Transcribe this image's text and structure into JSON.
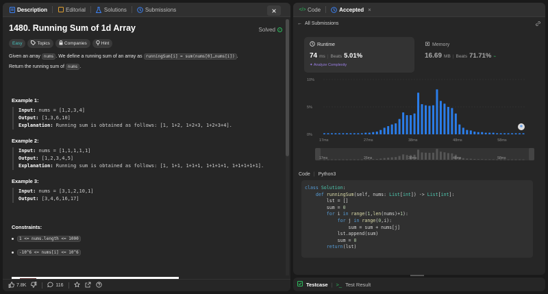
{
  "left_tabs": [
    {
      "label": "Description",
      "icon": "document-icon",
      "active": true
    },
    {
      "label": "Editorial",
      "icon": "book-icon",
      "active": false
    },
    {
      "label": "Solutions",
      "icon": "flask-icon",
      "active": false
    },
    {
      "label": "Submissions",
      "icon": "history-icon",
      "active": false
    }
  ],
  "close_label": "×",
  "problem": {
    "title": "1480. Running Sum of 1d Array",
    "status": "Solved",
    "tags": [
      {
        "label": "Easy",
        "icon": ""
      },
      {
        "label": "Topics",
        "icon": "tag-icon"
      },
      {
        "label": "Companies",
        "icon": "lock-icon"
      },
      {
        "label": "Hint",
        "icon": "bulb-icon"
      }
    ],
    "desc_p1": "Given an array ",
    "desc_c1": "nums",
    "desc_p2": ". We define a running sum of an array as ",
    "desc_c2": "runningSum[i] = sum(nums[0]…nums[i])",
    "desc_p3": ".",
    "ret_p1": "Return the running sum of ",
    "ret_c1": "nums",
    "ret_p2": "."
  },
  "examples": [
    {
      "title": "Example 1:",
      "input_label": "Input:",
      "input": " nums = [1,2,3,4]",
      "output_label": "Output:",
      "output": " [1,3,6,10]",
      "expl_label": "Explanation:",
      "expl": " Running sum is obtained as follows: [1, 1+2, 1+2+3, 1+2+3+4]."
    },
    {
      "title": "Example 2:",
      "input_label": "Input:",
      "input": " nums = [1,1,1,1,1]",
      "output_label": "Output:",
      "output": " [1,2,3,4,5]",
      "expl_label": "Explanation:",
      "expl": " Running sum is obtained as follows: [1, 1+1, 1+1+1, 1+1+1+1, 1+1+1+1+1]."
    },
    {
      "title": "Example 3:",
      "input_label": "Input:",
      "input": " nums = [3,1,2,10,1]",
      "output_label": "Output:",
      "output": " [3,4,6,16,17]"
    }
  ],
  "constraints": {
    "title": "Constraints:",
    "items": [
      "1 <= nums.length <= 1000",
      "-10^6 <= nums[i] <= 10^6"
    ]
  },
  "bottom": {
    "likes": "7.8K",
    "comments": "116"
  },
  "right_tabs": [
    {
      "label": "Code",
      "icon": "code-icon",
      "active": false
    },
    {
      "label": "Accepted",
      "icon": "history-icon",
      "active": true
    }
  ],
  "right_close": "×",
  "breadcrumb": "All Submissions",
  "runtime": {
    "title": "Runtime",
    "value": "74",
    "unit": "ms",
    "beats_label": "Beats",
    "beats": "5.01%",
    "analyze": "Analyze Complexity"
  },
  "memory": {
    "title": "Memory",
    "value": "16.69",
    "unit": "MB",
    "beats_label": "Beats",
    "beats": "71.71%"
  },
  "chart_data": {
    "type": "bar",
    "ylabels": [
      "10%",
      "5%",
      "0%"
    ],
    "ylim": [
      0,
      10
    ],
    "xlabels": [
      "17ms",
      "27ms",
      "38ms",
      "48ms",
      "58ms"
    ],
    "mini_labels": [
      "17ms",
      "26ms",
      "38ms",
      "48ms",
      "58ms"
    ],
    "values": [
      0.2,
      0.2,
      0.2,
      0.2,
      0.2,
      0.2,
      0.2,
      0.2,
      0.2,
      0.2,
      0.2,
      0.3,
      0.3,
      0.4,
      0.5,
      0.8,
      1.2,
      1.5,
      1.8,
      2.0,
      2.8,
      4.0,
      3.5,
      3.5,
      3.8,
      7.6,
      5.5,
      5.3,
      5.2,
      5.3,
      8.2,
      6.1,
      5.6,
      5.0,
      4.8,
      3.8,
      1.8,
      1.2,
      0.8,
      0.7,
      0.5,
      0.4,
      0.4,
      0.3,
      0.3,
      0.3,
      0.2,
      0.2,
      0.2,
      0.2,
      0.2,
      0.2,
      0.2,
      0.2
    ],
    "bar_color": "#2b7de9"
  },
  "code": {
    "lang_label": "Code",
    "lang": "Python3",
    "lines": [
      [
        [
          "kw",
          "class "
        ],
        [
          "cls",
          "Solution"
        ],
        [
          "",
          "​:"
        ]
      ],
      [
        [
          "",
          "    "
        ],
        [
          "kw",
          "def "
        ],
        [
          "fn",
          "runningSum"
        ],
        [
          "",
          "(self, nums: "
        ],
        [
          "cls",
          "List"
        ],
        [
          "",
          "["
        ],
        [
          "cls",
          "int"
        ],
        [
          "",
          "]) -> "
        ],
        [
          "cls",
          "List"
        ],
        [
          "",
          "["
        ],
        [
          "cls",
          "int"
        ],
        [
          "",
          "]:"
        ]
      ],
      [
        [
          "",
          "        lst = []"
        ]
      ],
      [
        [
          "",
          "        sum = "
        ],
        [
          "num",
          "0"
        ]
      ],
      [
        [
          "",
          "        "
        ],
        [
          "kw",
          "for "
        ],
        [
          "",
          "i "
        ],
        [
          "kw",
          "in "
        ],
        [
          "fn",
          "range"
        ],
        [
          "",
          "("
        ],
        [
          "num",
          "1"
        ],
        [
          "",
          ","
        ],
        [
          "fn",
          "len"
        ],
        [
          "",
          "(nums)+"
        ],
        [
          "num",
          "1"
        ],
        [
          "",
          "):"
        ]
      ],
      [
        [
          "",
          "            "
        ],
        [
          "kw",
          "for "
        ],
        [
          "",
          "j "
        ],
        [
          "kw",
          "in "
        ],
        [
          "fn",
          "range"
        ],
        [
          "",
          "("
        ],
        [
          "num",
          "0"
        ],
        [
          "",
          ",i):"
        ]
      ],
      [
        [
          "",
          "                sum = sum + nums[j]"
        ]
      ],
      [
        [
          "",
          "            lst.append(sum)"
        ]
      ],
      [
        [
          "",
          "            sum = "
        ],
        [
          "num",
          "0"
        ]
      ],
      [
        [
          "",
          "        "
        ],
        [
          "kw",
          "return"
        ],
        [
          "",
          "(lst)"
        ]
      ]
    ]
  },
  "testcase_tabs": [
    {
      "label": "Testcase",
      "active": true
    },
    {
      "label": "Test Result",
      "active": false
    }
  ]
}
